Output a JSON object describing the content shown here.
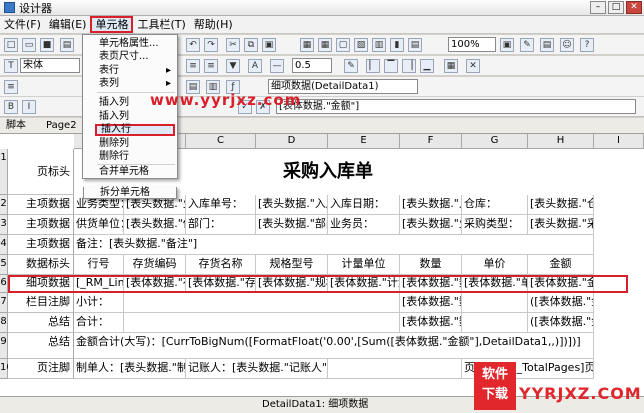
{
  "window": {
    "title": "设计器",
    "min": "–",
    "max": "□",
    "close": "✕"
  },
  "menu": [
    "文件(F)",
    "编辑(E)",
    "单元格",
    "工具栏(T)",
    "帮助(H)"
  ],
  "toolbar1": {
    "zoom": "100%"
  },
  "toolbar2": {
    "font": "宋体",
    "line_width": "0.5",
    "field": "细项数据(DetailData1)"
  },
  "formula": "[表体数据.\"金额\"]",
  "tabs": [
    "脚本",
    "Page2"
  ],
  "dropdown": {
    "items": [
      "单元格属性...",
      "表页尺寸...",
      "表行",
      "表列",
      "插入列",
      "插入列",
      "插入行",
      "删除列",
      "删除行",
      "合并单元格",
      "拆分单元格"
    ]
  },
  "watermark": "www.yyrjxz.com",
  "columns": [
    "A",
    "B",
    "C",
    "D",
    "E",
    "F",
    "G",
    "H",
    "I"
  ],
  "rows": [
    {
      "num": "1",
      "label": "页标头",
      "cells": [
        "",
        "",
        "",
        "采购入库单",
        "",
        "",
        "",
        "",
        ""
      ]
    },
    {
      "num": "2",
      "label": "主项数据",
      "cells": [
        "业务类型：",
        "[表头数据.\"业务类型\"]",
        "入库单号：",
        "[表头数据.\"入库单号\"]",
        "入库日期：",
        "[表头数据.\"入库日期\"]",
        "仓库：",
        "[表头数据.\"仓库\"]",
        ""
      ]
    },
    {
      "num": "3",
      "label": "主项数据",
      "cells": [
        "供货单位：",
        "[表头数据.\"供货单位\"]",
        "部门：",
        "[表头数据.\"部门\"]",
        "业务员：",
        "[表头数据.\"业务员\"]",
        "采购类型：",
        "[表头数据.\"采购类型\"]",
        ""
      ]
    },
    {
      "num": "4",
      "label": "主项数据",
      "cells": [
        "备注：[表头数据.\"备注\"]",
        "",
        "",
        "",
        "",
        "",
        "",
        "",
        ""
      ]
    },
    {
      "num": "5",
      "label": "数据标头",
      "cells": [
        "行号",
        "存货编码",
        "存货名称",
        "规格型号",
        "计量单位",
        "数量",
        "单价",
        "金额",
        ""
      ]
    },
    {
      "num": "6",
      "label": "细项数据",
      "cells": [
        "[_RM_Line]",
        "[表体数据.\"存货编码\"]",
        "[表体数据.\"存货名称\"]",
        "[表体数据.\"规格型号\"]",
        "[表体数据.\"计量单位\"]",
        "[表体数据.\"数量\"]",
        "[表体数据.\"单价\"]",
        "[表体数据.\"金额\"]",
        ""
      ]
    },
    {
      "num": "7",
      "label": "栏目注脚",
      "cells": [
        "小计：",
        "",
        "",
        "",
        "",
        "[表体数据.\"数量\"]",
        "",
        "([表体数据.\"金额\"])",
        ""
      ]
    },
    {
      "num": "8",
      "label": "总结",
      "cells": [
        "合计：",
        "",
        "",
        "",
        "",
        "[表体数据.\"数量\"]",
        "",
        "([表体数据.\"金额\"])",
        ""
      ]
    },
    {
      "num": "9",
      "label": "总结",
      "cells": [
        "金额合计(大写)：[CurrToBigNum([FormatFloat('0.00',[Sum([表体数据.\"金额\"],DetailData1,,)])])]",
        "",
        "",
        "",
        "",
        "",
        "",
        "",
        ""
      ]
    },
    {
      "num": "10",
      "label": "页注脚",
      "cells": [
        "制单人：[表头数据.\"制单人\"]",
        "",
        "记账人：[表头数据.\"记账人\"]",
        "",
        "",
        "",
        "",
        "页/共[_RM_TotalPages]页",
        ""
      ]
    }
  ],
  "status": "DetailData1: 细项数据",
  "logo": {
    "line1": "软件",
    "line2": "下载",
    "text": "YYRJXZ.COM"
  }
}
